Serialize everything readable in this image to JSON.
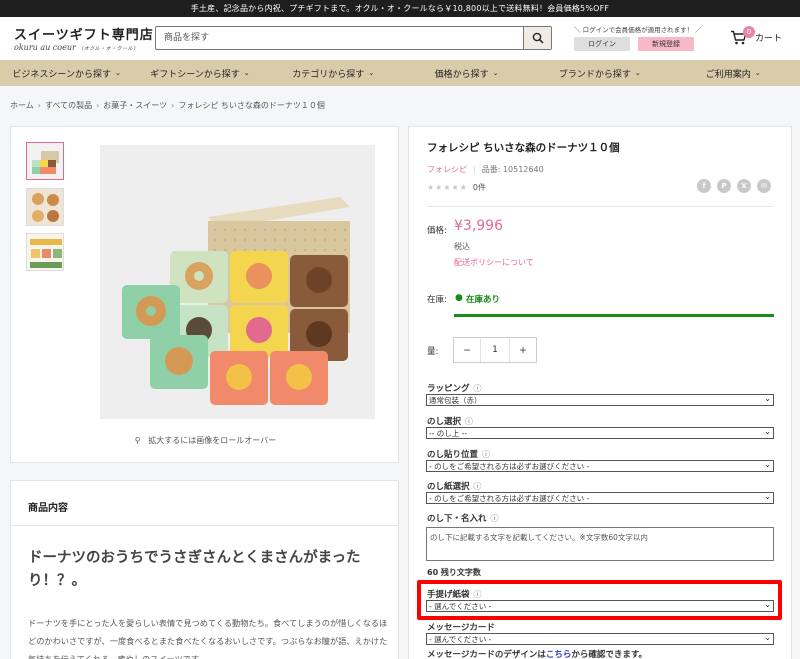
{
  "topbar": {
    "text": "手土産、記念品から内祝、プチギフトまで。オクル・オ・クールなら￥10,800以上で送料無料！会員価格5%OFF"
  },
  "header": {
    "logo_main": "スイーツギフト専門店",
    "logo_sub": "okuru au coeur",
    "logo_sub_kana": "（オクル・オ・クール）",
    "search_placeholder": "商品を探す",
    "login_note": "＼ ログインで会員価格が適用されます！ ／",
    "login_label": "ログイン",
    "register_label": "新規登録",
    "cart_count": "0",
    "cart_label": "カート"
  },
  "nav": [
    {
      "label": "ビジネスシーンから探す"
    },
    {
      "label": "ギフトシーンから探す"
    },
    {
      "label": "カテゴリから探す"
    },
    {
      "label": "価格から探す"
    },
    {
      "label": "ブランドから探す"
    },
    {
      "label": "ご利用案内"
    }
  ],
  "breadcrumb": [
    "ホーム",
    "すべての製品",
    "お菓子・スイーツ",
    "フォレシピ ちいさな森のドーナツ１０個"
  ],
  "gallery": {
    "zoom_hint": "拡大するには画像をロールオーバー"
  },
  "description": {
    "heading": "商品内容",
    "title": "ドーナツのおうちでうさぎさんとくまさんがまったり！？。",
    "body": "ドーナツを手にとった人を愛らしい表情で見つめてくる動物たち。食べてしまうのが惜しくなるほどのかわいさですが、一度食べるとまた食べたくなるおいしさです。つぶらなお瞳が語、えかけた気持ちを伝えてくれる、癒やしのスイーツです。"
  },
  "product": {
    "title": "フォレシピ ちいさな森のドーナツ１０個",
    "brand": "フォレシピ",
    "sku": "品番: 10512640",
    "stars": "★★★★★",
    "review_count": "0件",
    "social": [
      "f",
      "P",
      "X",
      "✉"
    ],
    "price_label": "価格:",
    "price": "¥3,996",
    "tax": "税込",
    "policy_link": "配送ポリシーについて",
    "stock_label": "在庫:",
    "stock_value": "在庫あり",
    "qty_label": "量:",
    "qty_value": "1",
    "minus": "−",
    "plus": "+"
  },
  "options": {
    "wrapping_label": "ラッピング",
    "wrapping_value": "通常包装（赤）",
    "noshi_label": "のし選択",
    "noshi_value": "-- のし上 --",
    "noshi_position_label": "のし貼り位置",
    "noshi_position_value": "- のしをご希望される方は必ずお選びください -",
    "noshi_paper_label": "のし紙選択",
    "noshi_paper_value": "- のしをご希望される方は必ずお選びください -",
    "name_label": "のし下・名入れ",
    "name_placeholder": "のし下に記載する文字を記載してください。※文字数60文字以内",
    "remaining": "60 残り文字数",
    "bag_label": "手提げ紙袋",
    "bag_value": "- 選んでください -",
    "card_label": "メッセージカード",
    "card_value": "- 選んでください -",
    "card_note_pre": "メッセージカードのデザインは",
    "card_note_link": "こちら",
    "card_note_post": "から確認できます。",
    "info_icon": "ⓘ"
  }
}
